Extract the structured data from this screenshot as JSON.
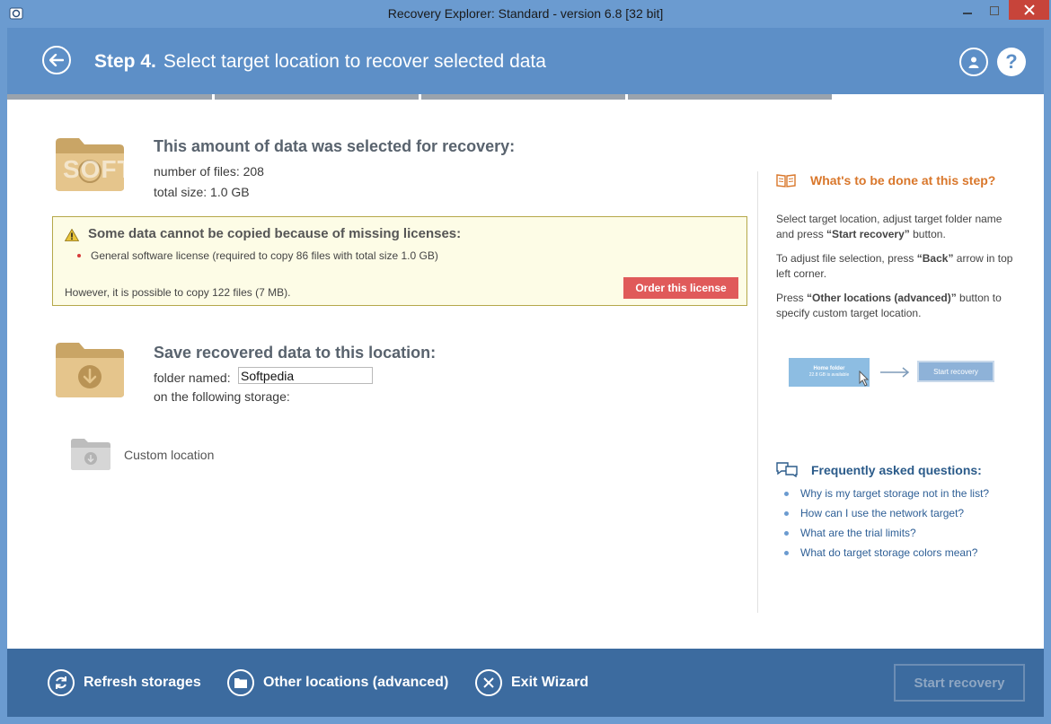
{
  "window": {
    "title": "Recovery Explorer: Standard - version 6.8 [32 bit]"
  },
  "header": {
    "step_label": "Step 4.",
    "step_text": "Select target location to recover selected data"
  },
  "selected": {
    "title": "This amount of data was selected for recovery:",
    "files_line": "number of files: 208",
    "size_line": "total size: 1.0 GB"
  },
  "license_warning": {
    "title": "Some data cannot be copied because of missing licenses:",
    "item": "General software license (required to copy 86 files with total size 1.0 GB)",
    "footer": "However, it is possible to copy 122 files (7 MB).",
    "order_button": "Order this license"
  },
  "save": {
    "title": "Save recovered data to this location:",
    "folder_label": "folder named:",
    "folder_value": "Softpedia",
    "storage_label": "on the following storage:",
    "custom_location": "Custom location"
  },
  "help": {
    "title": "What's to be done at this step?",
    "p1_pre": "Select target location, adjust target folder name and press ",
    "p1_bold": "“Start recovery”",
    "p1_post": " button.",
    "p2_pre": "To adjust file selection, press ",
    "p2_bold": "“Back”",
    "p2_post": " arrow in top left corner.",
    "p3_pre": "Press ",
    "p3_bold": "“Other locations (advanced)”",
    "p3_post": " button to specify custom target location.",
    "illus_folder": "Home folder",
    "illus_sub": "22.8 GB is available",
    "illus_button": "Start recovery"
  },
  "faq": {
    "title": "Frequently asked questions:",
    "items": [
      "Why is my target storage not in the list?",
      "How can I use the network target?",
      "What are the trial limits?",
      "What do target storage colors mean?"
    ]
  },
  "bottom": {
    "refresh": "Refresh storages",
    "other": "Other locations (advanced)",
    "exit": "Exit Wizard",
    "start": "Start recovery"
  },
  "watermark": "SOFTPEDIA",
  "colors": {
    "accent": "#5d8fc7",
    "bottom_bar": "#3c6b9f",
    "order_button": "#e05a5a",
    "help_title": "#d9772b",
    "faq_title": "#2b5b8a"
  }
}
